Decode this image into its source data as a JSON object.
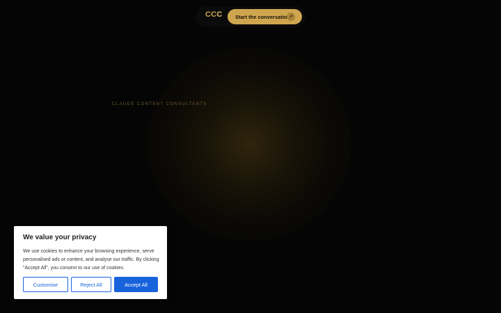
{
  "header": {
    "logo_text_a": "CC",
    "logo_text_b": "C",
    "cta_label": "Start the conversation",
    "cta_icon": "arrow-up-right-icon"
  },
  "hero": {
    "eyebrow": "CLAUDE CONTENT CONSULTANTS"
  },
  "cookie_banner": {
    "title": "We value your privacy",
    "body": "We use cookies to enhance your browsing experience, serve personalised ads or content, and analyse our traffic. By clicking \"Accept All\", you consent to our use of cookies.",
    "customise_label": "Customise",
    "reject_label": "Reject All",
    "accept_label": "Accept All"
  },
  "colors": {
    "background": "#050505",
    "accent_gold": "#cfa650",
    "cookie_blue": "#1863dc"
  }
}
